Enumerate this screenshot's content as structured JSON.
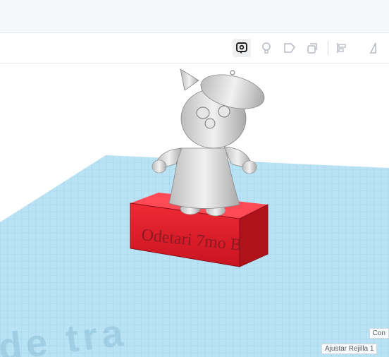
{
  "toolbar": {
    "icons": [
      "comment-icon",
      "lightbulb-icon",
      "shape-icon",
      "duplicate-icon",
      "align-icon",
      "mirror-icon"
    ]
  },
  "model": {
    "engraved_text": "Odetari 7mo B"
  },
  "workplane": {
    "watermark": "de tra",
    "snap_button_label": "Ajustar Rejilla",
    "snap_value": "1",
    "corner_label": "Con"
  },
  "colors": {
    "grid": "#9fd3ea",
    "base_block": "#e01e2b",
    "figure": "#d9d9d9"
  }
}
